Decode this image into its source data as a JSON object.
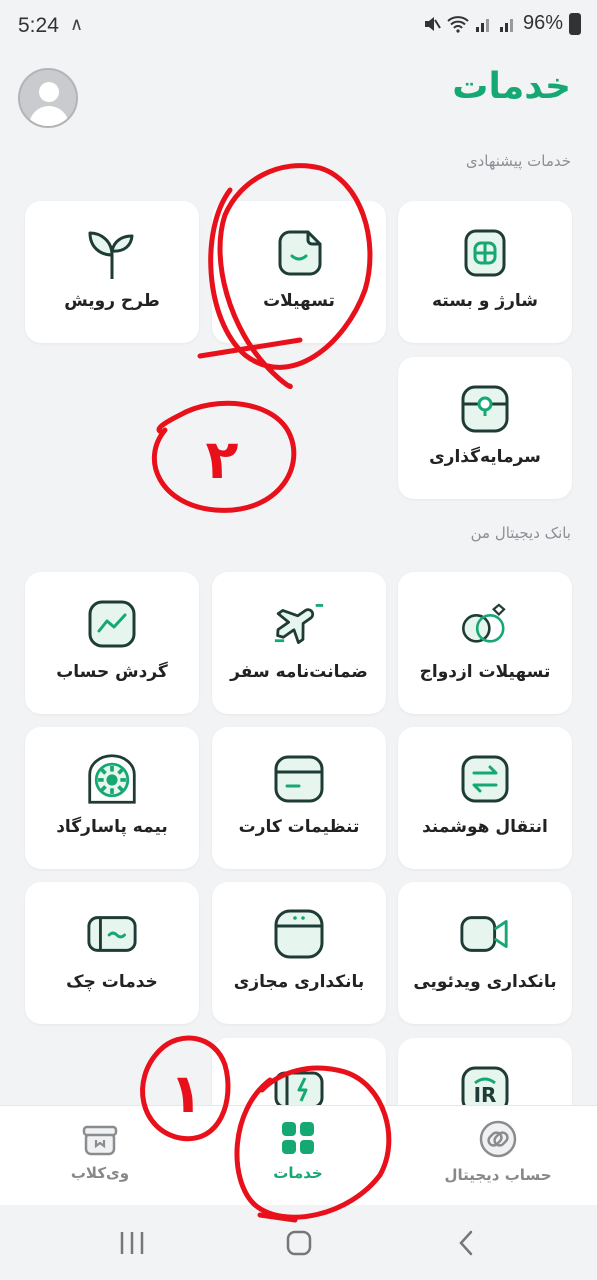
{
  "status": {
    "time": "5:24",
    "up_glyph": "∧",
    "battery": "96%"
  },
  "header": {
    "title": "خدمات"
  },
  "sections": {
    "suggested": "خدمات پیشنهادی",
    "digital": "بانک دیجیتال من"
  },
  "cards": {
    "charge": "شارژ و بسته",
    "facilities": "تسهیلات",
    "growth": "طرح رویش",
    "investment": "سرمایه‌گذاری",
    "marriage": "تسهیلات ازدواج",
    "travel": "ضمانت‌نامه سفر",
    "statement": "گردش حساب",
    "transfer": "انتقال هوشمند",
    "card_settings": "تنظیمات کارت",
    "insurance": "بیمه پاسارگاد",
    "video_banking": "بانکداری ویدئویی",
    "virtual_banking": "بانکداری مجازی",
    "cheque": "خدمات چک"
  },
  "bottom_nav": {
    "account": "حساب دیجیتال",
    "services": "خدمات",
    "club": "وی‌کلاب"
  },
  "annotations": {
    "one": "۱",
    "two": "۲"
  },
  "colors": {
    "brand": "#16a873",
    "annotation": "#e8101a"
  },
  "icons": {
    "charge": "sim-card-icon",
    "facilities": "smile-doc-icon",
    "growth": "sprout-icon",
    "investment": "safe-icon",
    "marriage": "rings-icon",
    "travel": "airplane-icon",
    "statement": "chart-icon",
    "transfer": "arrows-exchange-icon",
    "card_settings": "card-icon",
    "insurance": "pasargad-logo-icon",
    "video_banking": "video-camera-icon",
    "virtual_banking": "device-icon",
    "cheque": "cheque-icon"
  }
}
